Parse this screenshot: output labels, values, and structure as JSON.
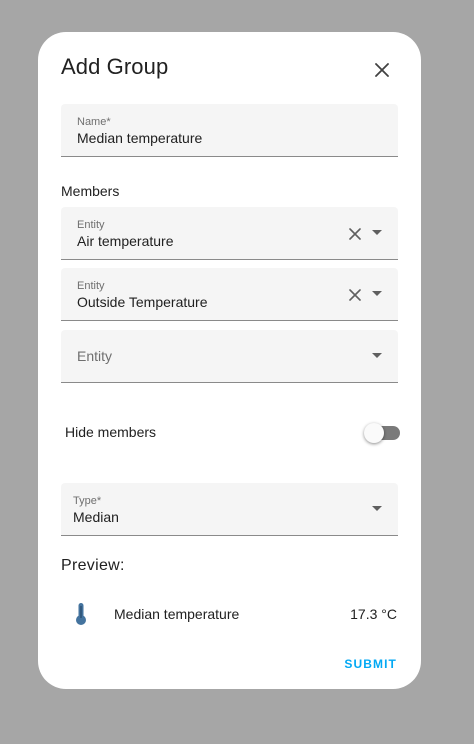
{
  "dialog": {
    "title": "Add Group"
  },
  "name_field": {
    "label": "Name*",
    "value": "Median temperature"
  },
  "members": {
    "label": "Members",
    "entities": [
      {
        "label": "Entity",
        "value": "Air temperature"
      },
      {
        "label": "Entity",
        "value": "Outside Temperature"
      },
      {
        "label": "Entity",
        "value": ""
      }
    ]
  },
  "hide_members": {
    "label": "Hide members",
    "checked": false
  },
  "type_field": {
    "label": "Type*",
    "value": "Median"
  },
  "preview": {
    "title": "Preview:",
    "icon": "thermometer-icon",
    "name": "Median temperature",
    "value": "17.3 °C"
  },
  "actions": {
    "submit_label": "SUBMIT"
  },
  "colors": {
    "accent": "#03a9f4",
    "icon": "#44739e"
  }
}
